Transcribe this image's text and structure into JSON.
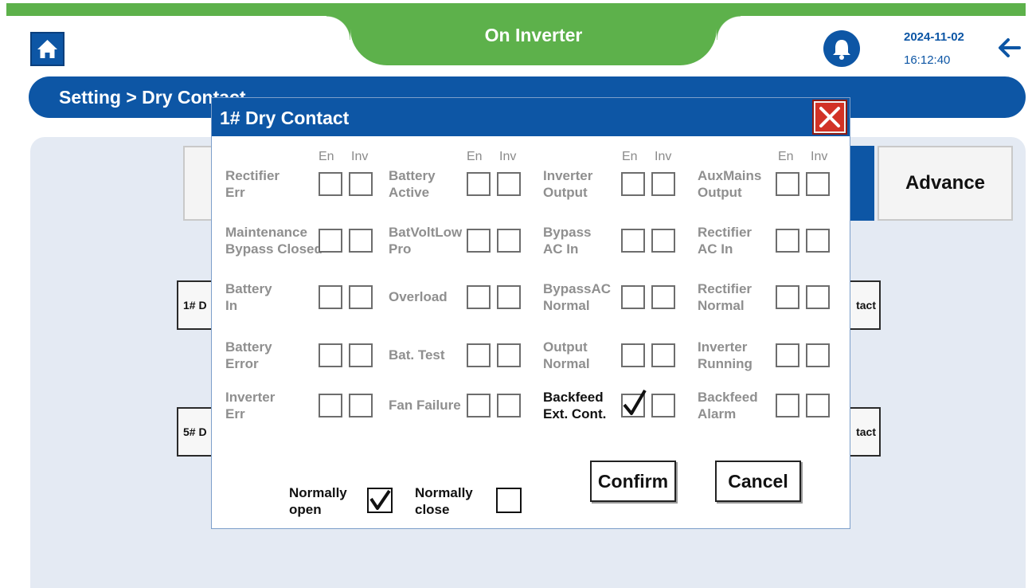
{
  "header": {
    "status": "On Inverter",
    "date": "2024-11-02",
    "time": "16:12:40",
    "icons": {
      "home": "home-icon",
      "bell": "bell-icon",
      "back": "back-arrow-icon"
    }
  },
  "breadcrumb": "Setting > Dry Contact",
  "background": {
    "advance_tab": "Advance",
    "left_buttons": [
      "1# D",
      "5# D"
    ],
    "right_buttons": [
      "tact",
      "tact"
    ]
  },
  "dialog": {
    "title": "1# Dry Contact",
    "col_en": "En",
    "col_inv": "Inv",
    "items": [
      {
        "line1": "Rectifier",
        "line2": "Err",
        "en": false,
        "inv": false
      },
      {
        "line1": "Battery",
        "line2": "Active",
        "en": false,
        "inv": false
      },
      {
        "line1": "Inverter",
        "line2": "Output",
        "en": false,
        "inv": false
      },
      {
        "line1": "AuxMains",
        "line2": "Output",
        "en": false,
        "inv": false
      },
      {
        "line1": "Maintenance",
        "line2": "Bypass Closed",
        "en": false,
        "inv": false
      },
      {
        "line1": "BatVoltLow",
        "line2": "Pro",
        "en": false,
        "inv": false
      },
      {
        "line1": "Bypass",
        "line2": "AC In",
        "en": false,
        "inv": false
      },
      {
        "line1": "Rectifier",
        "line2": "AC In",
        "en": false,
        "inv": false
      },
      {
        "line1": "Battery",
        "line2": "In",
        "en": false,
        "inv": false
      },
      {
        "line1": "Overload",
        "line2": "",
        "en": false,
        "inv": false
      },
      {
        "line1": "BypassAC",
        "line2": "Normal",
        "en": false,
        "inv": false
      },
      {
        "line1": "Rectifier",
        "line2": "Normal",
        "en": false,
        "inv": false
      },
      {
        "line1": "Battery",
        "line2": "Error",
        "en": false,
        "inv": false
      },
      {
        "line1": "Bat. Test",
        "line2": "",
        "en": false,
        "inv": false
      },
      {
        "line1": "Output",
        "line2": "Normal",
        "en": false,
        "inv": false
      },
      {
        "line1": "Inverter",
        "line2": "Running",
        "en": false,
        "inv": false
      },
      {
        "line1": "Inverter",
        "line2": "Err",
        "en": false,
        "inv": false
      },
      {
        "line1": "Fan Failure",
        "line2": "",
        "en": false,
        "inv": false
      },
      {
        "line1": "Backfeed",
        "line2": "Ext. Cont.",
        "en": true,
        "inv": false,
        "active": true
      },
      {
        "line1": "Backfeed",
        "line2": "Alarm",
        "en": false,
        "inv": false
      }
    ],
    "normally_open": {
      "line1": "Normally",
      "line2": "open",
      "checked": true
    },
    "normally_close": {
      "line1": "Normally",
      "line2": "close",
      "checked": false
    },
    "confirm": "Confirm",
    "cancel": "Cancel"
  }
}
